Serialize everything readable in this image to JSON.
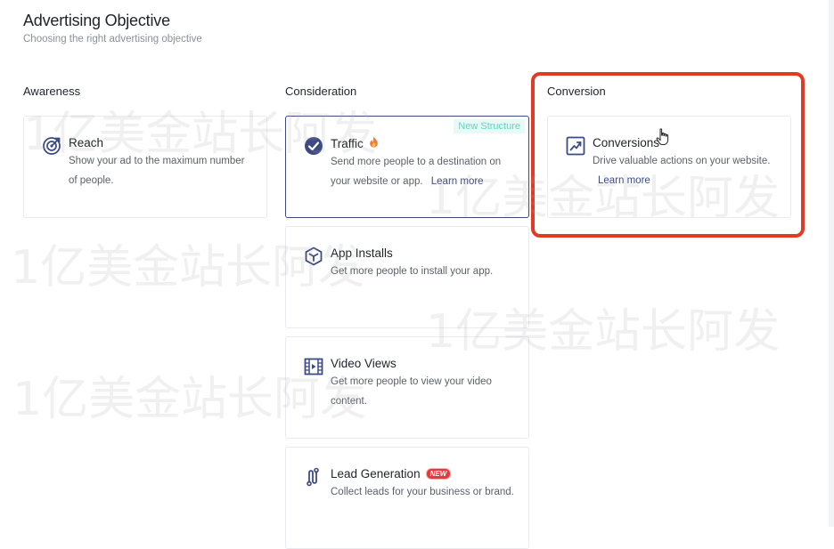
{
  "header": {
    "title": "Advertising Objective",
    "subtitle": "Choosing the right advertising objective"
  },
  "columns": {
    "awareness": {
      "title": "Awareness",
      "cards": [
        {
          "name": "Reach",
          "desc": "Show your ad to the maximum number of people.",
          "icon": "target-icon"
        }
      ]
    },
    "consideration": {
      "title": "Consideration",
      "cards": [
        {
          "name": "Traffic",
          "desc": "Send more people to a destination on your website or app.",
          "learn_more": "Learn more",
          "badge": "New Structure",
          "icon": "check-circle-icon",
          "selected": true
        },
        {
          "name": "App Installs",
          "desc": "Get more people to install your app.",
          "icon": "cube-icon"
        },
        {
          "name": "Video Views",
          "desc": "Get more people to view your video content.",
          "icon": "video-icon"
        },
        {
          "name": "Lead Generation",
          "desc": "Collect leads for your business or brand.",
          "badge": "NEW",
          "icon": "lead-icon"
        }
      ]
    },
    "conversion": {
      "title": "Conversion",
      "cards": [
        {
          "name": "Conversions",
          "desc": "Drive valuable actions on your website.",
          "learn_more": "Learn more",
          "icon": "trend-up-icon"
        }
      ]
    }
  },
  "watermark": "1亿美金站长阿发",
  "colors": {
    "accent": "#3d4b83",
    "highlight": "#e13b26",
    "badge_teal": "#59d8c2",
    "badge_red": "#e5393f"
  }
}
